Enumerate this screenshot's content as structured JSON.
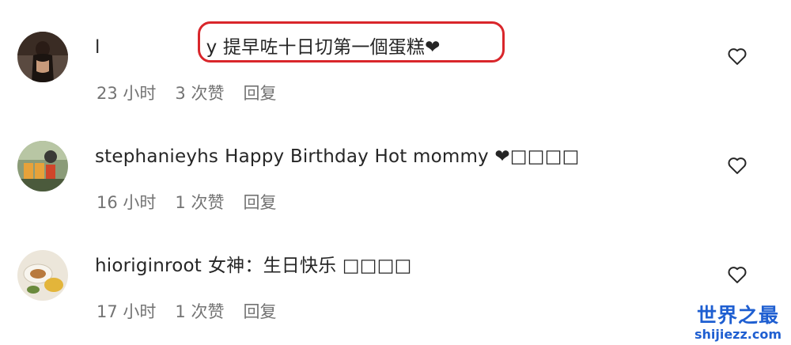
{
  "comments": [
    {
      "username": "l",
      "text": "y 提早咗十日切第一個蛋糕❤",
      "time": "23 小时",
      "likes": "3 次赞",
      "reply": "回复",
      "avatar_icon": "user-avatar-photo"
    },
    {
      "username": "stephanieyhs",
      "text": "Happy Birthday Hot mommy ❤□□□□",
      "time": "16 小时",
      "likes": "1 次赞",
      "reply": "回复",
      "avatar_icon": "user-avatar-photo"
    },
    {
      "username": "hioriginroot",
      "text": "女神：生日快乐 □□□□",
      "time": "17 小时",
      "likes": "1 次赞",
      "reply": "回复",
      "avatar_icon": "user-avatar-photo"
    }
  ],
  "watermark": {
    "title": "世界之最",
    "subtitle": "shijiezz.com"
  },
  "colors": {
    "text": "#262626",
    "meta": "#737373",
    "highlight": "#d9262b",
    "watermark": "#1f5fd1"
  },
  "icons": {
    "like": "heart-outline-icon"
  }
}
